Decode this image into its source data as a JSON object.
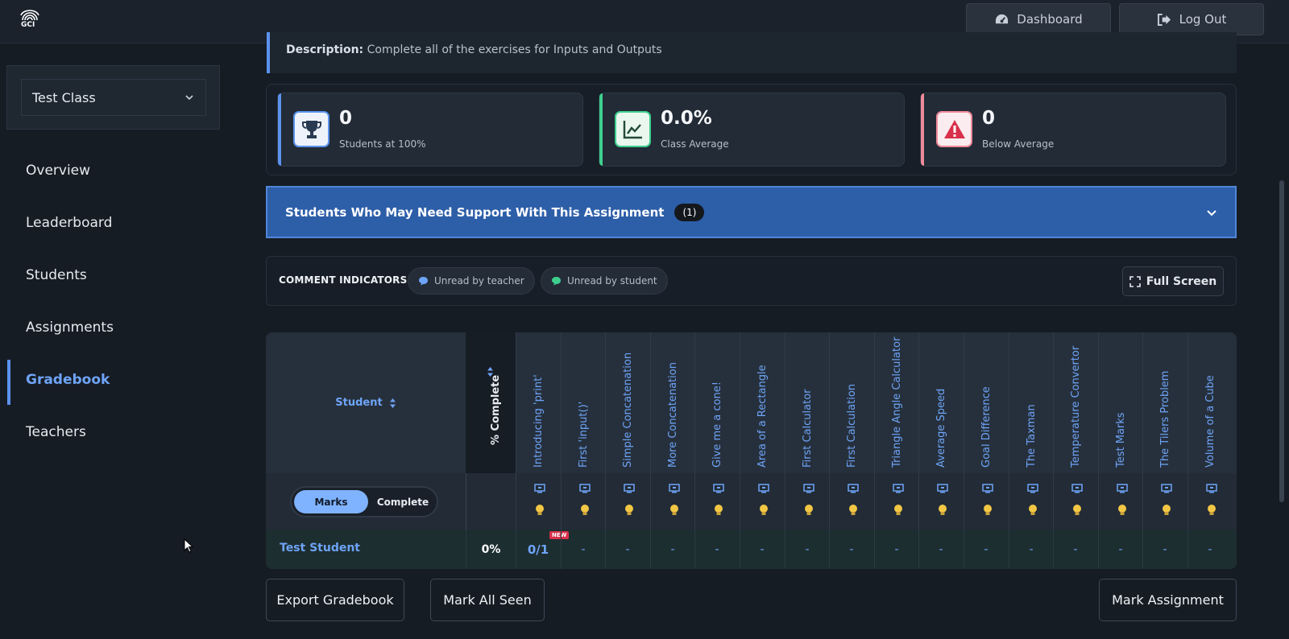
{
  "app": {
    "logo_text": "GCI"
  },
  "header": {
    "dashboard_label": "Dashboard",
    "logout_label": "Log Out"
  },
  "sidebar": {
    "class_select_value": "Test Class",
    "items": [
      {
        "label": "Overview"
      },
      {
        "label": "Leaderboard"
      },
      {
        "label": "Students"
      },
      {
        "label": "Assignments"
      },
      {
        "label": "Gradebook",
        "active": true
      },
      {
        "label": "Teachers"
      }
    ]
  },
  "assignment": {
    "description_label": "Description:",
    "description_text": "Complete all of the exercises for Inputs and Outputs"
  },
  "stats": [
    {
      "value": "0",
      "label": "Students at 100%",
      "icon": "trophy-icon",
      "color": "#5b93ee"
    },
    {
      "value": "0.0%",
      "label": "Class Average",
      "icon": "chart-line-icon",
      "color": "#3ecf8e"
    },
    {
      "value": "0",
      "label": "Below Average",
      "icon": "warning-icon",
      "color": "#f08a9a"
    }
  ],
  "support": {
    "title": "Students Who May Need Support With This Assignment",
    "count": "(1)"
  },
  "comments": {
    "title": "COMMENT INDICATORS",
    "unread_teacher": "Unread by teacher",
    "unread_student": "Unread by student",
    "full_screen": "Full Screen"
  },
  "gradebook": {
    "student_header": "Student",
    "percent_header": "% Complete",
    "toggle": {
      "marks": "Marks",
      "complete": "Complete",
      "selected": "Marks"
    },
    "exercises": [
      "Introducing 'print'",
      "First 'input()'",
      "Simple Concatenation",
      "More Concatenation",
      "Give me a cone!",
      "Area of a Rectangle",
      "First Calculator",
      "First Calculation",
      "Triangle Angle Calculator",
      "Average Speed",
      "Goal Difference",
      "The Taxman",
      "Temperature Convertor",
      "Test Marks",
      "The Tilers Problem",
      "Volume of a Cube"
    ],
    "rows": [
      {
        "student": "Test Student",
        "percent": "0%",
        "new_badge": "NEW",
        "cells": [
          "0/1",
          "-",
          "-",
          "-",
          "-",
          "-",
          "-",
          "-",
          "-",
          "-",
          "-",
          "-",
          "-",
          "-",
          "-",
          "-"
        ]
      }
    ]
  },
  "actions": {
    "export": "Export Gradebook",
    "mark_all_seen": "Mark All Seen",
    "mark_assignment": "Mark Assignment"
  }
}
